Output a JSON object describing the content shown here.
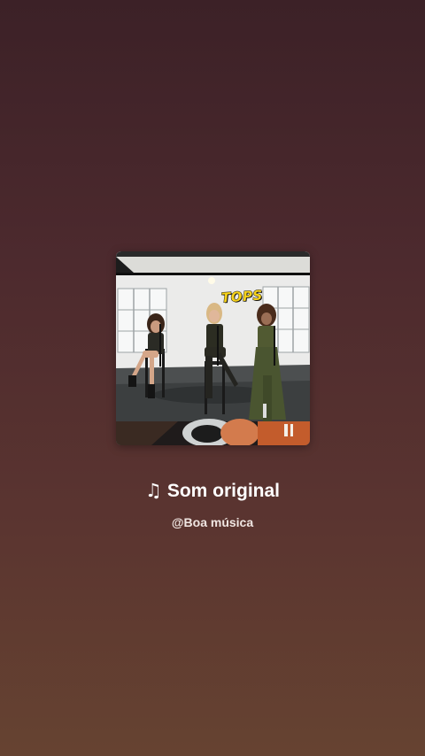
{
  "sound": {
    "title": "Som original",
    "author": "@Boa música",
    "note_icon": "music-note-icon"
  },
  "cover": {
    "sticker_text": "TOPS"
  },
  "colors": {
    "background_top": "#3c2127",
    "background_bottom": "#664331",
    "text_primary": "#ffffff",
    "text_secondary": "#f0e6e2",
    "sticker": "#f6d21a"
  }
}
